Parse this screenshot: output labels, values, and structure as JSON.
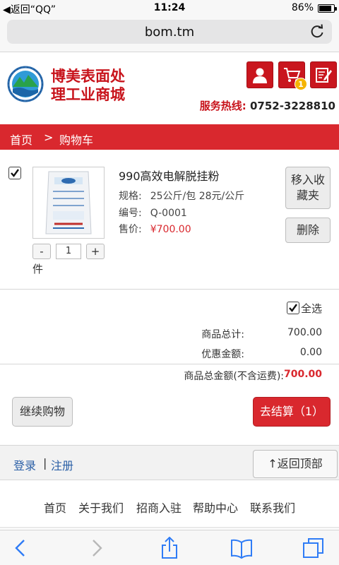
{
  "status_bar": {
    "back_label": "◀返回“QQ”",
    "time": "11:24",
    "battery_percent": "86%",
    "battery_level": 0.86
  },
  "browser": {
    "url": "bom.tm",
    "reload_icon": "reload-icon"
  },
  "header": {
    "brand_line1": "博美表面处",
    "brand_line2": "理工业商城",
    "hotline_label": "服务热线:",
    "hotline_number": "0752-3228810",
    "cart_count": "1",
    "accent_color": "#d9282e"
  },
  "breadcrumb": {
    "home": "首页",
    "separator": ">",
    "current": "购物车"
  },
  "cart_item": {
    "checked": true,
    "name": "990高效电解脱挂粉",
    "spec_label": "规格:",
    "spec_value": "25公斤/包 28元/公斤",
    "code_label": "编号:",
    "code_value": "Q-0001",
    "price_label": "售价:",
    "price_value": "¥700.00",
    "qty_minus": "-",
    "qty_value": "1",
    "qty_plus": "+",
    "unit": "件",
    "favorite_line1": "移入收",
    "favorite_line2": "藏夹",
    "delete_label": "删除"
  },
  "totals": {
    "select_all": "全选",
    "subtotal_label": "商品总计:",
    "subtotal_value": "700.00",
    "discount_label": "优惠金额:",
    "discount_value": "0.00",
    "grand_label": "商品总金额(不含运费):",
    "grand_value": "700.00"
  },
  "actions": {
    "continue_label": "继续购物",
    "checkout_label": "去结算（1）"
  },
  "footer": {
    "login": "登录",
    "separator": "|",
    "register": "注册",
    "back_to_top": "↑返回顶部",
    "links": [
      "首页",
      "关于我们",
      "招商入驻",
      "帮助中心",
      "联系我们"
    ]
  }
}
